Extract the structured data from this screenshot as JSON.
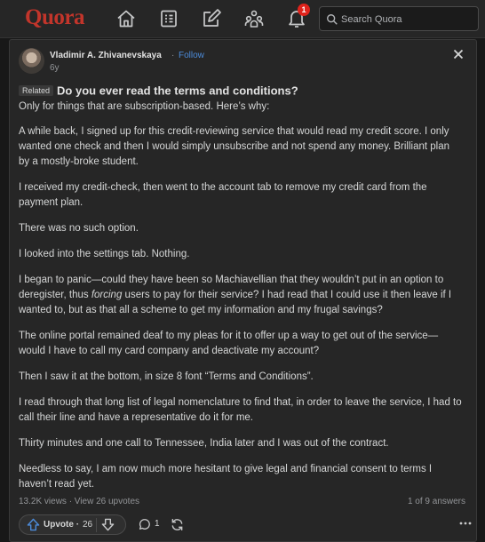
{
  "header": {
    "logo": "Quora",
    "notification_count": "1",
    "search_placeholder": "Search Quora",
    "icons": [
      "home-icon",
      "following-icon",
      "answer-icon",
      "spaces-icon",
      "notifications-icon",
      "search-icon"
    ],
    "logo_color": "#c2352b",
    "badge_color": "#e0231c"
  },
  "post": {
    "author": "Vladimir A. Zhivanevskaya",
    "separator": "·",
    "follow_label": "Follow",
    "age": "6y",
    "related_tag": "Related",
    "question": "Do you ever read the terms and conditions?",
    "paragraphs": {
      "p0": "Only for things that are subscription-based. Here’s why:",
      "p1": "A while back, I signed up for this credit-reviewing service that would read my credit score. I only wanted one check and then I would simply unsubscribe and not spend any money. Brilliant plan by a mostly-broke student.",
      "p2": "I received my credit-check, then went to the account tab to remove my credit card from the payment plan.",
      "p3": "There was no such option.",
      "p4": "I looked into the settings tab. Nothing.",
      "p5a": "I began to panic—could they have been so Machiavellian that they wouldn’t put in an option to deregister, thus ",
      "p5em": "forcing",
      "p5b": " users to pay for their service? I had read that I could use it then leave if I wanted to, but as that all a scheme to get my information and my frugal savings?",
      "p6": "The online portal remained deaf to my pleas for it to offer up a way to get out of the service—would I have to call my card company and deactivate my account?",
      "p7": "Then I saw it at the bottom, in size 8 font “Terms and Conditions”.",
      "p8": "I read through that long list of legal nomenclature to find that, in order to leave the service, I had to call their line and have a representative do it for me.",
      "p9": "Thirty minutes and one call to Tennessee, India later and I was out of the contract.",
      "p10": "Needless to say, I am now much more hesitant to give legal and financial consent to terms I haven’t read yet."
    },
    "stats": "13.2K views · View 26 upvotes",
    "answer_position": "1 of 9 answers",
    "follow_color": "#4c8cdb"
  },
  "actions": {
    "upvote_label": "Upvote",
    "upvote_separator": "·",
    "upvote_count": "26",
    "comment_count": "1",
    "icons": [
      "upvote-icon",
      "downvote-icon",
      "comment-icon",
      "share-icon",
      "more-icon"
    ]
  }
}
